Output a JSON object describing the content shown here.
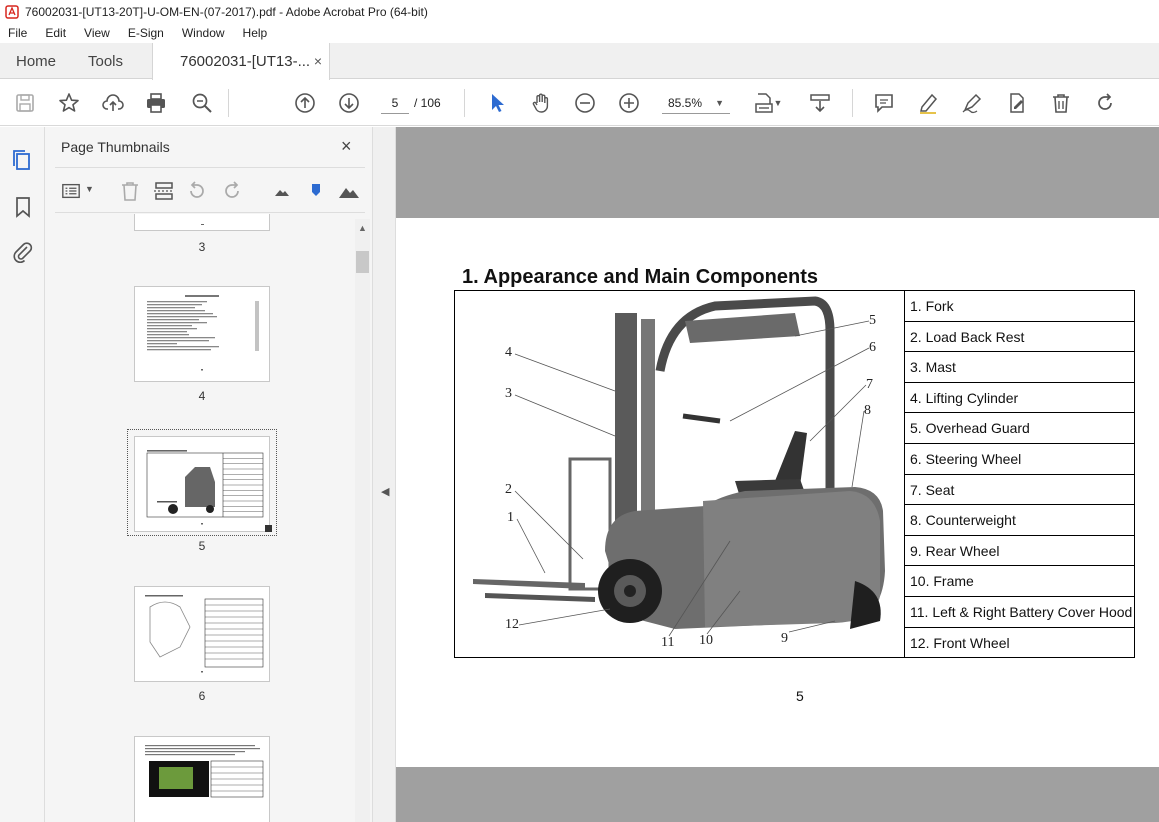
{
  "window": {
    "title": "76002031-[UT13-20T]-U-OM-EN-(07-2017).pdf - Adobe Acrobat Pro (64-bit)"
  },
  "menu": [
    "File",
    "Edit",
    "View",
    "E-Sign",
    "Window",
    "Help"
  ],
  "tabs": {
    "home": "Home",
    "tools": "Tools",
    "doc": "76002031-[UT13-...",
    "close": "×"
  },
  "toolbar": {
    "page_current": "5",
    "page_total": "/ 106",
    "zoom": "85.5%"
  },
  "panel": {
    "title": "Page Thumbnails",
    "close": "×",
    "thumbnails": [
      {
        "label": "3"
      },
      {
        "label": "4"
      },
      {
        "label": "5",
        "selected": true
      },
      {
        "label": "6"
      }
    ]
  },
  "document": {
    "heading": "1. Appearance and Main Components",
    "components": [
      "1.  Fork",
      "2.  Load Back Rest",
      "3.  Mast",
      "4.  Lifting Cylinder",
      "5.  Overhead Guard",
      "6.  Steering Wheel",
      "7.  Seat",
      "8.  Counterweight",
      "9.  Rear Wheel",
      "10. Frame",
      "11. Left & Right Battery Cover Hood",
      "12. Front Wheel"
    ],
    "callouts": [
      "4",
      "3",
      "2",
      "1",
      "12",
      "11",
      "10",
      "9",
      "8",
      "7",
      "6",
      "5"
    ],
    "page_number": "5"
  },
  "colors": {
    "acrobat_red": "#d7261e",
    "select_blue": "#2d6bd1",
    "doc_gray": "#a0a0a0"
  }
}
